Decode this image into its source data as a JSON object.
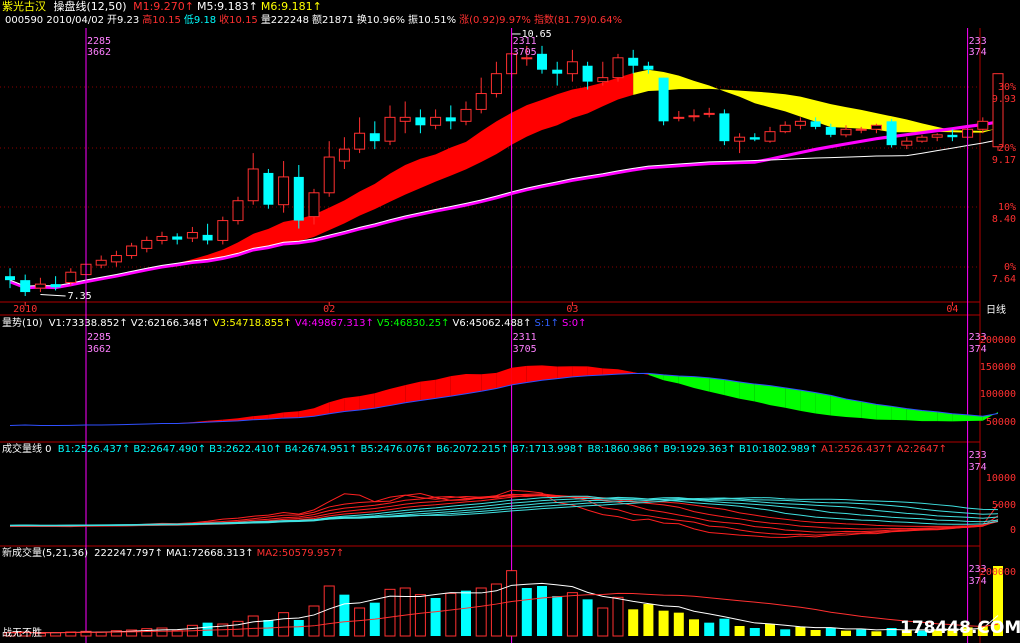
{
  "window": {
    "stock_name": "紫光古汉",
    "indicator_label": "操盘线(12,50)",
    "watermark": "178448.COM",
    "footer_left": "战无不胜"
  },
  "price_info": {
    "ma_line": [
      [
        "M1:9.270",
        "#ff3030"
      ],
      [
        "M5:9.183",
        "#ffffff"
      ],
      [
        "M6:9.181",
        "#ffff00"
      ]
    ],
    "row": [
      [
        "000590 2010/04/02",
        "#ffffff"
      ],
      [
        "开9.23",
        "#ffffff"
      ],
      [
        "高10.15",
        "#ff3030"
      ],
      [
        "低9.18",
        "#00ffff"
      ],
      [
        "收10.15",
        "#ff3030"
      ],
      [
        "量222248",
        "#ffffff"
      ],
      [
        "额21871",
        "#ffffff"
      ],
      [
        "换10.96%",
        "#ffffff"
      ],
      [
        "振10.51%",
        "#ffffff"
      ],
      [
        "涨(0.92)9.97%",
        "#ff3030"
      ],
      [
        "指数(81.79)0.64%",
        "#ff3030"
      ]
    ]
  },
  "markers": {
    "left_top": "2285",
    "left_bot": "3662",
    "mid_top": "2311",
    "mid_bot": "3705",
    "right_top": "233",
    "right_bot": "374"
  },
  "price_chart": {
    "high_label": "10.65",
    "low_label": "7.35",
    "yaxis": [
      [
        "30%",
        "9.93"
      ],
      [
        "20%",
        "9.17"
      ],
      [
        "10%",
        "8.40"
      ],
      [
        "0%",
        "7.64"
      ]
    ],
    "xaxis": [
      "2010",
      "02",
      "03",
      "04"
    ],
    "period": "日线"
  },
  "volume_panel": {
    "title": "量势(10)",
    "legend": [
      [
        "V1:73338.852",
        "#ffffff"
      ],
      [
        "V2:62166.348",
        "#ffffff"
      ],
      [
        "V3:54718.855",
        "#ffff00"
      ],
      [
        "V4:49867.313",
        "#ff00ff"
      ],
      [
        "V5:46830.25",
        "#00ff00"
      ],
      [
        "V6:45062.488",
        "#ffffff"
      ],
      [
        "S:1",
        "#3060ff"
      ],
      [
        "S:0",
        "#ff00ff"
      ]
    ],
    "yaxis": [
      "200000",
      "150000",
      "100000",
      "50000"
    ]
  },
  "fan_panel": {
    "title": "成交量线 0",
    "legend": [
      [
        "B1:2526.437",
        "#00ffff"
      ],
      [
        "B2:2647.490",
        "#00ffff"
      ],
      [
        "B3:2622.410",
        "#00ffff"
      ],
      [
        "B4:2674.951",
        "#00ffff"
      ],
      [
        "B5:2476.076",
        "#00ffff"
      ],
      [
        "B6:2072.215",
        "#00ffff"
      ],
      [
        "B7:1713.998",
        "#00ffff"
      ],
      [
        "B8:1860.986",
        "#00ffff"
      ],
      [
        "B9:1929.363",
        "#00ffff"
      ],
      [
        "B10:1802.989",
        "#00ffff"
      ],
      [
        "A1:2526.437",
        "#ff3030"
      ],
      [
        "A2:2647",
        "#ff3030"
      ]
    ],
    "yaxis": [
      "10000",
      "5000",
      "0"
    ]
  },
  "newvol_panel": {
    "title": "新成交量(5,21,36)",
    "legend": [
      [
        "222247.797",
        "#ffffff"
      ],
      [
        "MA1:72668.313",
        "#ffffff"
      ],
      [
        "MA2:50579.957",
        "#ff3030"
      ]
    ],
    "yaxis": [
      "200000"
    ]
  },
  "chart_data": {
    "type": "candlestick",
    "price_range": [
      7.3,
      10.7
    ],
    "candles": [
      [
        7.6,
        7.55,
        7.7,
        7.45
      ],
      [
        7.55,
        7.4,
        7.62,
        7.35
      ],
      [
        7.45,
        7.5,
        7.58,
        7.4
      ],
      [
        7.5,
        7.46,
        7.6,
        7.42
      ],
      [
        7.52,
        7.65,
        7.7,
        7.48
      ],
      [
        7.62,
        7.75,
        7.8,
        7.55
      ],
      [
        7.74,
        7.8,
        7.86,
        7.7
      ],
      [
        7.78,
        7.86,
        7.92,
        7.72
      ],
      [
        7.86,
        7.98,
        8.02,
        7.82
      ],
      [
        7.95,
        8.05,
        8.1,
        7.9
      ],
      [
        8.05,
        8.1,
        8.16,
        8.0
      ],
      [
        8.1,
        8.06,
        8.14,
        8.0
      ],
      [
        8.08,
        8.15,
        8.22,
        8.03
      ],
      [
        8.12,
        8.05,
        8.26,
        8.0
      ],
      [
        8.05,
        8.3,
        8.35,
        8.0
      ],
      [
        8.3,
        8.55,
        8.6,
        8.25
      ],
      [
        8.55,
        8.95,
        9.15,
        8.5
      ],
      [
        8.9,
        8.5,
        8.95,
        8.45
      ],
      [
        8.5,
        8.85,
        9.05,
        8.4
      ],
      [
        8.85,
        8.3,
        9.0,
        8.2
      ],
      [
        8.35,
        8.65,
        8.7,
        8.25
      ],
      [
        8.65,
        9.1,
        9.3,
        8.6
      ],
      [
        9.05,
        9.2,
        9.35,
        8.95
      ],
      [
        9.2,
        9.4,
        9.6,
        9.15
      ],
      [
        9.4,
        9.3,
        9.55,
        9.2
      ],
      [
        9.3,
        9.6,
        9.75,
        9.25
      ],
      [
        9.55,
        9.6,
        9.8,
        9.4
      ],
      [
        9.6,
        9.5,
        9.7,
        9.4
      ],
      [
        9.5,
        9.6,
        9.7,
        9.45
      ],
      [
        9.6,
        9.55,
        9.75,
        9.45
      ],
      [
        9.55,
        9.7,
        9.8,
        9.5
      ],
      [
        9.7,
        9.9,
        10.1,
        9.65
      ],
      [
        9.9,
        10.15,
        10.3,
        9.85
      ],
      [
        10.15,
        10.4,
        10.65,
        10.1
      ],
      [
        10.35,
        10.35,
        10.5,
        10.25
      ],
      [
        10.4,
        10.2,
        10.5,
        10.15
      ],
      [
        10.2,
        10.15,
        10.3,
        10.0
      ],
      [
        10.15,
        10.3,
        10.45,
        10.05
      ],
      [
        10.25,
        10.05,
        10.3,
        9.95
      ],
      [
        10.05,
        10.1,
        10.3,
        10.0
      ],
      [
        10.1,
        10.35,
        10.4,
        10.05
      ],
      [
        10.35,
        10.25,
        10.45,
        10.15
      ],
      [
        10.25,
        10.2,
        10.3,
        10.15
      ],
      [
        10.1,
        9.55,
        10.1,
        9.5
      ],
      [
        9.6,
        9.6,
        9.68,
        9.55
      ],
      [
        9.62,
        9.62,
        9.7,
        9.55
      ],
      [
        9.65,
        9.65,
        9.72,
        9.6
      ],
      [
        9.65,
        9.3,
        9.7,
        9.25
      ],
      [
        9.3,
        9.35,
        9.4,
        9.15
      ],
      [
        9.35,
        9.32,
        9.4,
        9.3
      ],
      [
        9.3,
        9.42,
        9.48,
        9.28
      ],
      [
        9.42,
        9.5,
        9.55,
        9.4
      ],
      [
        9.5,
        9.55,
        9.6,
        9.45
      ],
      [
        9.55,
        9.48,
        9.6,
        9.45
      ],
      [
        9.48,
        9.38,
        9.52,
        9.35
      ],
      [
        9.38,
        9.45,
        9.5,
        9.35
      ],
      [
        9.45,
        9.45,
        9.48,
        9.4
      ],
      [
        9.45,
        9.5,
        9.52,
        9.4
      ],
      [
        9.55,
        9.25,
        9.58,
        9.22
      ],
      [
        9.25,
        9.3,
        9.35,
        9.2
      ],
      [
        9.3,
        9.35,
        9.38,
        9.28
      ],
      [
        9.35,
        9.38,
        9.4,
        9.3
      ],
      [
        9.38,
        9.35,
        9.45,
        9.3
      ],
      [
        9.35,
        9.45,
        9.5,
        9.32
      ],
      [
        9.45,
        9.55,
        9.6,
        9.4
      ],
      [
        9.23,
        10.15,
        10.15,
        9.18
      ]
    ],
    "newvol_bars": [
      [
        5,
        0
      ],
      [
        6,
        0
      ],
      [
        4,
        0
      ],
      [
        5,
        0
      ],
      [
        6,
        0
      ],
      [
        7,
        0
      ],
      [
        6,
        0
      ],
      [
        8,
        0
      ],
      [
        9,
        0
      ],
      [
        11,
        0
      ],
      [
        12,
        0
      ],
      [
        8,
        0
      ],
      [
        16,
        0
      ],
      [
        20,
        1
      ],
      [
        18,
        0
      ],
      [
        22,
        0
      ],
      [
        30,
        0
      ],
      [
        24,
        1
      ],
      [
        35,
        0
      ],
      [
        24,
        1
      ],
      [
        45,
        0
      ],
      [
        75,
        0
      ],
      [
        62,
        1
      ],
      [
        42,
        0
      ],
      [
        50,
        1
      ],
      [
        70,
        0
      ],
      [
        72,
        0
      ],
      [
        62,
        0
      ],
      [
        57,
        1
      ],
      [
        64,
        0
      ],
      [
        68,
        1
      ],
      [
        72,
        0
      ],
      [
        78,
        0
      ],
      [
        98,
        0
      ],
      [
        72,
        1
      ],
      [
        75,
        1
      ],
      [
        60,
        1
      ],
      [
        65,
        0
      ],
      [
        55,
        1
      ],
      [
        42,
        0
      ],
      [
        58,
        0
      ],
      [
        40,
        2
      ],
      [
        48,
        2
      ],
      [
        38,
        2
      ],
      [
        35,
        2
      ],
      [
        25,
        2
      ],
      [
        20,
        1
      ],
      [
        26,
        1
      ],
      [
        15,
        2
      ],
      [
        12,
        1
      ],
      [
        18,
        2
      ],
      [
        10,
        1
      ],
      [
        14,
        2
      ],
      [
        9,
        2
      ],
      [
        12,
        1
      ],
      [
        8,
        2
      ],
      [
        10,
        1
      ],
      [
        7,
        2
      ],
      [
        12,
        1
      ],
      [
        9,
        2
      ],
      [
        8,
        1
      ],
      [
        10,
        2
      ],
      [
        11,
        2
      ],
      [
        13,
        2
      ],
      [
        15,
        2
      ],
      [
        105,
        2
      ]
    ]
  }
}
